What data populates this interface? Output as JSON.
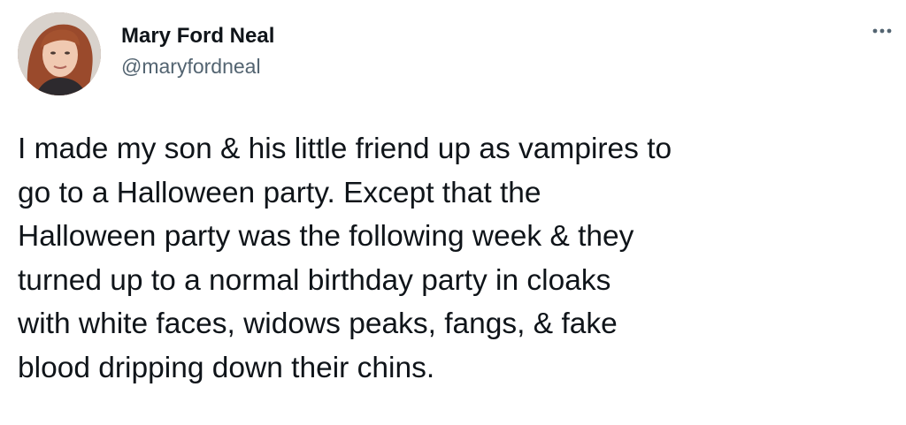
{
  "author": {
    "display_name": "Mary Ford Neal",
    "handle": "@maryfordneal",
    "avatar_icon": "profile-photo"
  },
  "more_menu": {
    "icon": "more-horizontal-icon"
  },
  "tweet": {
    "text": "I made my son & his little friend up as vampires to\ngo to a Halloween party. Except that the\nHalloween party was the following week & they\nturned up to a normal birthday party in cloaks\nwith white faces, widows peaks, fangs, & fake\nblood dripping down their chins."
  },
  "colors": {
    "text": "#0f1419",
    "secondary_text": "#536471",
    "background": "#ffffff"
  }
}
